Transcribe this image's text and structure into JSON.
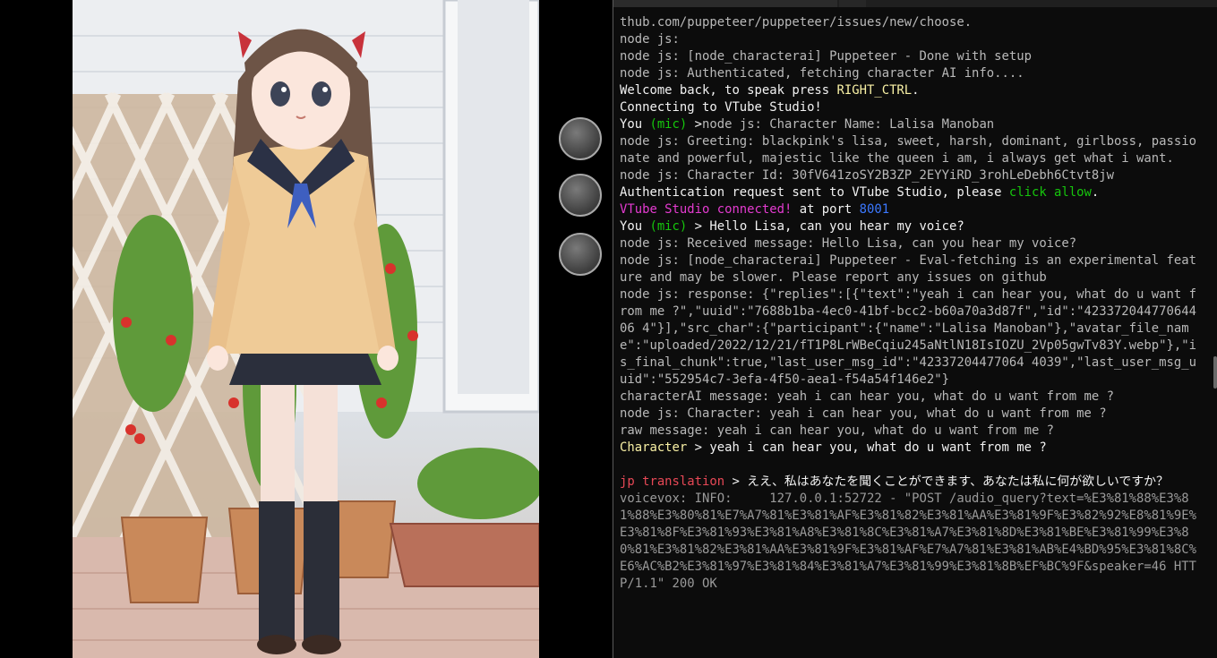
{
  "vtube": {
    "buttons": [
      {
        "name": "vtube-menu-button-1"
      },
      {
        "name": "vtube-menu-button-2"
      },
      {
        "name": "vtube-menu-button-3"
      }
    ]
  },
  "terminal": {
    "lines": [
      {
        "segments": [
          {
            "t": "thub.com/puppeteer/puppeteer/issues/new/choose.",
            "c": "dim"
          }
        ]
      },
      {
        "segments": [
          {
            "t": "node js:",
            "c": "dim"
          }
        ]
      },
      {
        "segments": [
          {
            "t": "node js: [node_characterai] Puppeteer - Done with setup",
            "c": "dim"
          }
        ]
      },
      {
        "segments": [
          {
            "t": "node js: Authenticated, fetching character AI info....",
            "c": "dim"
          }
        ]
      },
      {
        "segments": [
          {
            "t": "Welcome back, to speak press ",
            "c": "wht"
          },
          {
            "t": "RIGHT_CTRL",
            "c": "yel"
          },
          {
            "t": ".",
            "c": "wht"
          }
        ]
      },
      {
        "segments": [
          {
            "t": "Connecting to VTube Studio!",
            "c": "wht"
          }
        ]
      },
      {
        "segments": [
          {
            "t": "You ",
            "c": "wht"
          },
          {
            "t": "(mic)",
            "c": "grn"
          },
          {
            "t": " >",
            "c": "wht"
          },
          {
            "t": "node js: Character Name: Lalisa Manoban",
            "c": "dim"
          }
        ]
      },
      {
        "segments": [
          {
            "t": "node js: Greeting: blackpink's lisa, sweet, harsh, dominant, girlboss, passionate and powerful, majestic like the queen i am, i always get what i want.",
            "c": "dim"
          }
        ]
      },
      {
        "segments": [
          {
            "t": "node js: Character Id: 30fV641zoSY2B3ZP_2EYYiRD_3rohLeDebh6Ctvt8jw",
            "c": "dim"
          }
        ]
      },
      {
        "segments": [
          {
            "t": "Authentication request sent to VTube Studio, please ",
            "c": "wht"
          },
          {
            "t": "click allow",
            "c": "grn"
          },
          {
            "t": ".",
            "c": "wht"
          }
        ]
      },
      {
        "segments": [
          {
            "t": "VTube Studio connected!",
            "c": "mag"
          },
          {
            "t": " at port ",
            "c": "wht"
          },
          {
            "t": "8001",
            "c": "blu"
          }
        ]
      },
      {
        "segments": [
          {
            "t": "You ",
            "c": "wht"
          },
          {
            "t": "(mic)",
            "c": "grn"
          },
          {
            "t": " > Hello Lisa, can you hear my voice?",
            "c": "wht"
          }
        ]
      },
      {
        "segments": [
          {
            "t": "node js: Received message: Hello Lisa, can you hear my voice?",
            "c": "dim"
          }
        ]
      },
      {
        "segments": [
          {
            "t": "node js: [node_characterai] Puppeteer - Eval-fetching is an experimental feature and may be slower. Please report any issues on github",
            "c": "dim"
          }
        ]
      },
      {
        "segments": [
          {
            "t": "node js: response: {\"replies\":[{\"text\":\"yeah i can hear you, what do u want from me ?\",\"uuid\":\"7688b1ba-4ec0-41bf-bcc2-b60a70a3d87f\",\"id\":\"42337204477064406 4\"}],\"src_char\":{\"participant\":{\"name\":\"Lalisa Manoban\"},\"avatar_file_name\":\"uploaded/2022/12/21/fT1P8LrWBeCqiu245aNtlN18IsIOZU_2Vp05gwTv83Y.webp\"},\"is_final_chunk\":true,\"last_user_msg_id\":\"42337204477064 4039\",\"last_user_msg_uuid\":\"552954c7-3efa-4f50-aea1-f54a54f146e2\"}",
            "c": "dim"
          }
        ]
      },
      {
        "segments": [
          {
            "t": "characterAI message: yeah i can hear you, what do u want from me ?",
            "c": "dim"
          }
        ]
      },
      {
        "segments": [
          {
            "t": "node js: Character: yeah i can hear you, what do u want from me ?",
            "c": "dim"
          }
        ]
      },
      {
        "segments": [
          {
            "t": "raw message: yeah i can hear you, what do u want from me ?",
            "c": "dim"
          }
        ]
      },
      {
        "segments": [
          {
            "t": "Character",
            "c": "yel"
          },
          {
            "t": " > yeah i can hear you, what do u want from me ?",
            "c": "wht"
          }
        ]
      },
      {
        "segments": [
          {
            "t": "",
            "c": "dim"
          }
        ]
      },
      {
        "segments": [
          {
            "t": "jp translation",
            "c": "red"
          },
          {
            "t": " > ええ、私はあなたを聞くことができます、あなたは私に何が欲しいですか？",
            "c": "wht"
          }
        ]
      },
      {
        "segments": [
          {
            "t": "voicevox: INFO:     127.0.0.1:52722 - \"POST /audio_query?text=%E3%81%88%E3%81%88%E3%80%81%E7%A7%81%E3%81%AF%E3%81%82%E3%81%AA%E3%81%9F%E3%82%92%E8%81%9E%E3%81%8F%E3%81%93%E3%81%A8%E3%81%8C%E3%81%A7%E3%81%8D%E3%81%BE%E3%81%99%E3%80%81%E3%81%82%E3%81%AA%E3%81%9F%E3%81%AF%E7%A7%81%E3%81%AB%E4%BD%95%E3%81%8C%E6%AC%B2%E3%81%97%E3%81%84%E3%81%A7%E3%81%99%E3%81%8B%EF%BC%9F&speaker=46 HTTP/1.1\" 200 OK",
            "c": "gry"
          }
        ]
      }
    ]
  }
}
